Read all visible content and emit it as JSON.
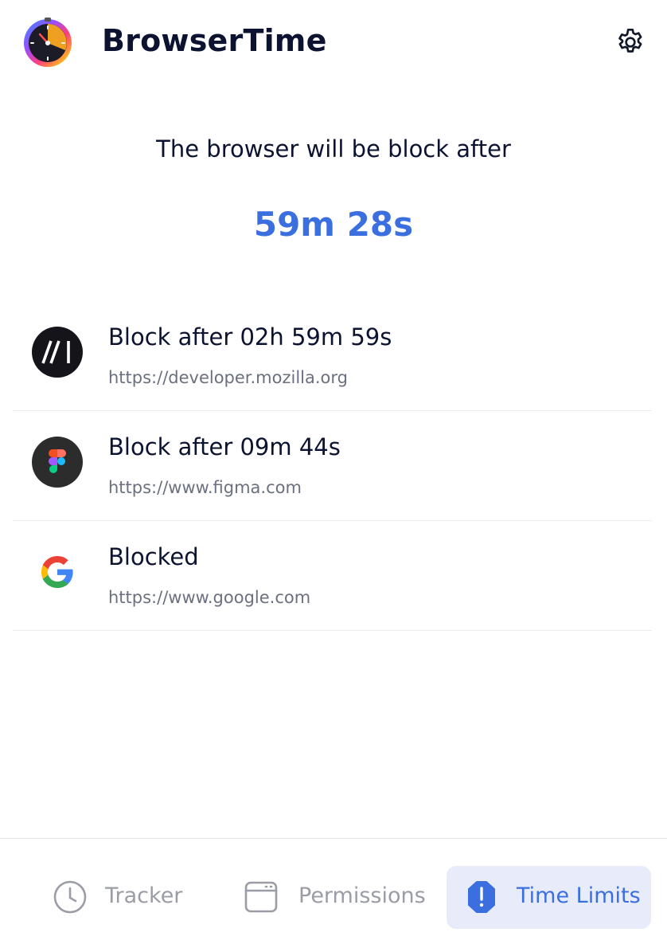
{
  "header": {
    "app_title": "BrowserTime",
    "logo_icon": "stopwatch-logo-icon",
    "settings_icon": "gear-icon"
  },
  "countdown": {
    "caption": "The browser will be block after",
    "remaining": "59m 28s",
    "accent_color": "#3b6fe0"
  },
  "sites": [
    {
      "status": "Block after 02h 59m 59s",
      "url": "https://developer.mozilla.org",
      "icon": "mdn-logo-icon"
    },
    {
      "status": "Block after 09m 44s",
      "url": "https://www.figma.com",
      "icon": "figma-logo-icon"
    },
    {
      "status": "Blocked",
      "url": "https://www.google.com",
      "icon": "google-logo-icon"
    }
  ],
  "nav": {
    "tabs": [
      {
        "label": "Tracker",
        "icon": "clock-icon",
        "active": false
      },
      {
        "label": "Permissions",
        "icon": "browser-window-icon",
        "active": false
      },
      {
        "label": "Time Limits",
        "icon": "alert-hexagon-icon",
        "active": true
      }
    ]
  }
}
